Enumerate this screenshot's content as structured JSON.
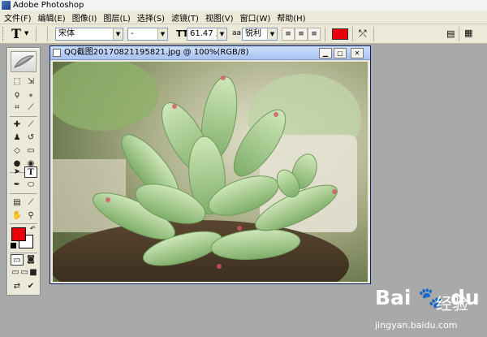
{
  "app": {
    "title": "Adobe Photoshop"
  },
  "menu": [
    "文件(F)",
    "编辑(E)",
    "图像(I)",
    "图层(L)",
    "选择(S)",
    "滤镜(T)",
    "视图(V)",
    "窗口(W)",
    "帮助(H)"
  ],
  "options": {
    "tool_glyph": "T",
    "font_family": "宋体",
    "font_style": "-",
    "font_size": "61.47 点",
    "aa_label": "aa",
    "antialias": "锐利",
    "text_color": "#e8000b"
  },
  "document": {
    "title": "QQ截图20170821195821.jpg @ 100%(RGB/8)"
  },
  "colors": {
    "foreground": "#e8000b",
    "background": "#ffffff"
  },
  "watermark": {
    "brand": "Bai 🐾 du",
    "cn": "经验",
    "url": "jingyan.baidu.com"
  }
}
